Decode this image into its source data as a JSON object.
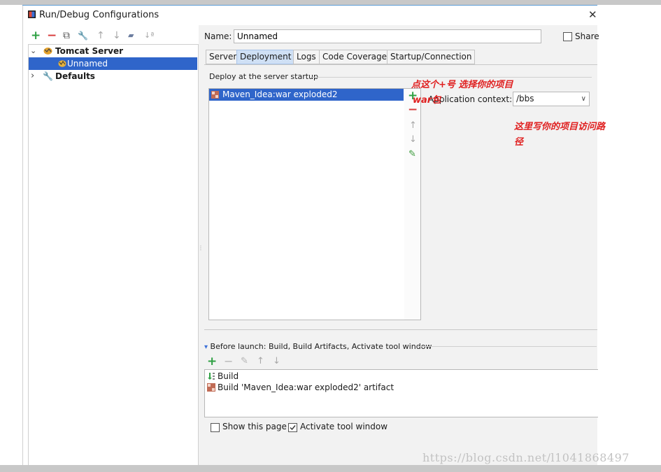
{
  "window": {
    "title": "Run/Debug Configurations",
    "close_glyph": "✕"
  },
  "left_toolbar": {
    "add": "+",
    "remove": "−",
    "copy": "⧉",
    "edit": "🔧",
    "up": "↑",
    "down": "↓",
    "folder": "▰",
    "sort": "↓ª"
  },
  "tree": {
    "items": [
      {
        "label": "Tomcat Server",
        "expander": "⌄"
      },
      {
        "label": "Unnamed"
      },
      {
        "label": "Defaults",
        "expander": "›"
      }
    ]
  },
  "form": {
    "name_label": "Name:",
    "name_value": "Unnamed",
    "share_label": "Share"
  },
  "tabs": [
    {
      "label": "Server"
    },
    {
      "label": "Deployment"
    },
    {
      "label": "Logs"
    },
    {
      "label": "Code Coverage"
    },
    {
      "label": "Startup/Connection"
    }
  ],
  "deployment": {
    "group_label": "Deploy at the server startup",
    "artifact": "Maven_Idea:war exploded2",
    "side_buttons": {
      "add": "+",
      "remove": "−",
      "up": "↑",
      "down": "↓",
      "edit": "✎"
    },
    "context_label": "Application context:",
    "context_value": "/bbs",
    "chevron": "∨"
  },
  "annotations": {
    "line1": "点这个+号 选择你的项目",
    "line2": "war包",
    "line3": "这里写你的项目访问路",
    "line4": "径"
  },
  "before_launch": {
    "label": "Before launch: Build, Build Artifacts, Activate tool window",
    "toggle": "▾",
    "toolbar": {
      "add": "+",
      "remove": "−",
      "edit": "✎",
      "up": "↑",
      "down": "↓"
    },
    "items": [
      {
        "label": "Build"
      },
      {
        "label": "Build 'Maven_Idea:war exploded2' artifact"
      }
    ]
  },
  "options": {
    "show_page_label": "Show this page",
    "show_page_checked": false,
    "activate_label": "Activate tool window",
    "activate_checked": true
  },
  "watermark": "https://blog.csdn.net/l1041868497",
  "colors": {
    "selection": "#2f65ca",
    "add_green": "#2ea043",
    "remove_red": "#d83b3b",
    "annotation_red": "#e02020",
    "active_tab": "#cfe0f5"
  }
}
